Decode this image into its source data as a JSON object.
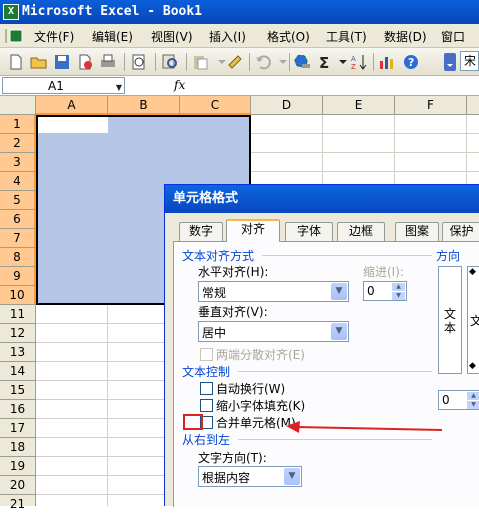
{
  "window": {
    "title": "Microsoft Excel - Book1",
    "app_icon": "excel-icon"
  },
  "menu": [
    "文件(F)",
    "编辑(E)",
    "视图(V)",
    "插入(I)",
    "格式(O)",
    "工具(T)",
    "数据(D)",
    "窗口"
  ],
  "toolbar": {
    "font_combo": "宋"
  },
  "formula_bar": {
    "name_box": "A1",
    "fx": "fx"
  },
  "sheet": {
    "columns": [
      "A",
      "B",
      "C",
      "D",
      "E",
      "F"
    ],
    "rows": [
      "1",
      "2",
      "3",
      "4",
      "5",
      "6",
      "7",
      "8",
      "9",
      "10",
      "11",
      "12",
      "13",
      "14",
      "15",
      "16",
      "17",
      "18",
      "19",
      "20",
      "21"
    ],
    "selection": "A1:C10"
  },
  "dialog": {
    "title": "单元格格式",
    "tabs": [
      "数字",
      "对齐",
      "字体",
      "边框",
      "图案",
      "保护"
    ],
    "active_tab": "对齐",
    "text_alignment": {
      "group_label": "文本对齐方式",
      "horizontal_label": "水平对齐(H):",
      "horizontal_value": "常规",
      "indent_label": "缩进(I):",
      "indent_value": "0",
      "vertical_label": "垂直对齐(V):",
      "vertical_value": "居中",
      "distributed_label": "两端分散对齐(E)"
    },
    "text_control": {
      "group_label": "文本控制",
      "wrap_text": "自动换行(W)",
      "shrink_to_fit": "缩小字体填充(K)",
      "merge_cells": "合并单元格(M)"
    },
    "rtl": {
      "group_label": "从右到左",
      "direction_label": "文字方向(T):",
      "direction_value": "根据内容"
    },
    "orientation": {
      "group_label": "方向",
      "vertical_text": "文本",
      "partial_text": "文",
      "degrees_value": "0"
    }
  },
  "annotation": {
    "color": "#e02020"
  }
}
